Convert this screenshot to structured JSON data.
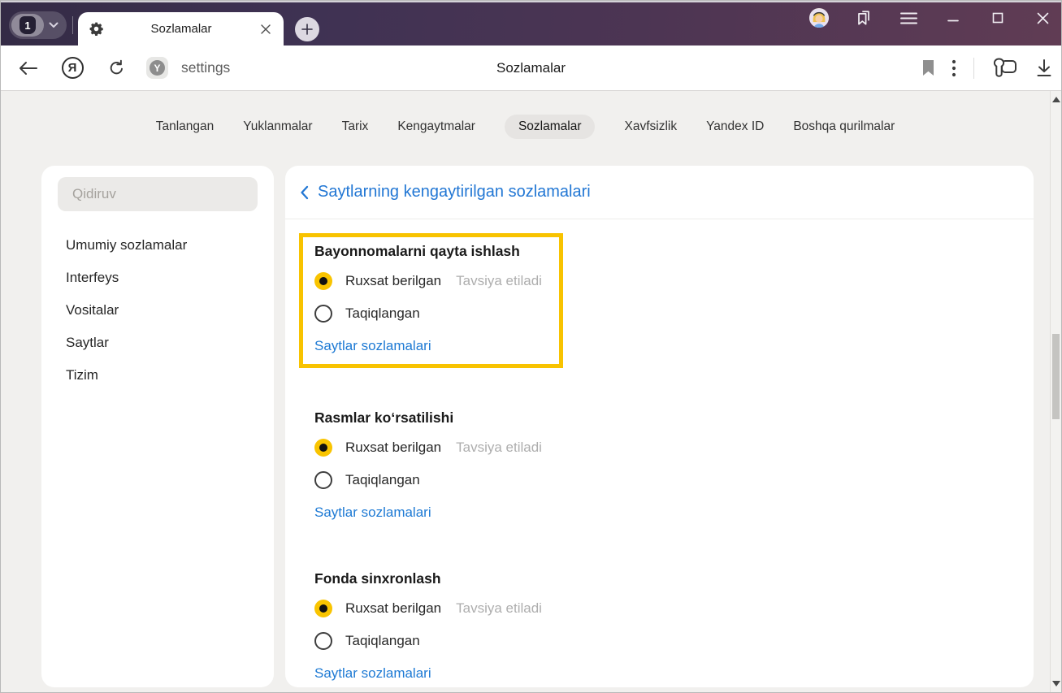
{
  "titlebar": {
    "tab_count": "1",
    "active_tab": {
      "title": "Sozlamalar"
    }
  },
  "toolbar": {
    "yandex_logo_glyph": "Я",
    "protect_glyph": "Y",
    "url_text": "settings",
    "page_title": "Sozlamalar"
  },
  "nav": {
    "active": "Sozlamalar",
    "items": [
      "Tanlangan",
      "Yuklanmalar",
      "Tarix",
      "Kengaytmalar",
      "Sozlamalar",
      "Xavfsizlik",
      "Yandex ID",
      "Boshqa qurilmalar"
    ]
  },
  "sidebar": {
    "search_placeholder": "Qidiruv",
    "items": [
      "Umumiy sozlamalar",
      "Interfeys",
      "Vositalar",
      "Saytlar",
      "Tizim"
    ]
  },
  "main": {
    "heading": "Saytlarning kengaytirilgan sozlamalari",
    "options": {
      "allowed": "Ruxsat berilgan",
      "recommended_note": "Tavsiya etiladi",
      "blocked": "Taqiqlangan",
      "sites_link": "Saytlar sozlamalari"
    },
    "sections": [
      {
        "title": "Bayonnomalarni qayta ishlash",
        "selected": "allowed",
        "highlighted": true
      },
      {
        "title": "Rasmlar koʻrsatilishi",
        "selected": "allowed",
        "highlighted": false
      },
      {
        "title": "Fonda sinxronlash",
        "selected": "allowed",
        "highlighted": false
      }
    ]
  },
  "colors": {
    "accent_blue": "#2277d4",
    "highlight_yellow": "#f8c300",
    "radio_selected_yellow": "#f9c400",
    "titlebar_gradient_start": "#342b45",
    "titlebar_gradient_end": "#603c54"
  }
}
